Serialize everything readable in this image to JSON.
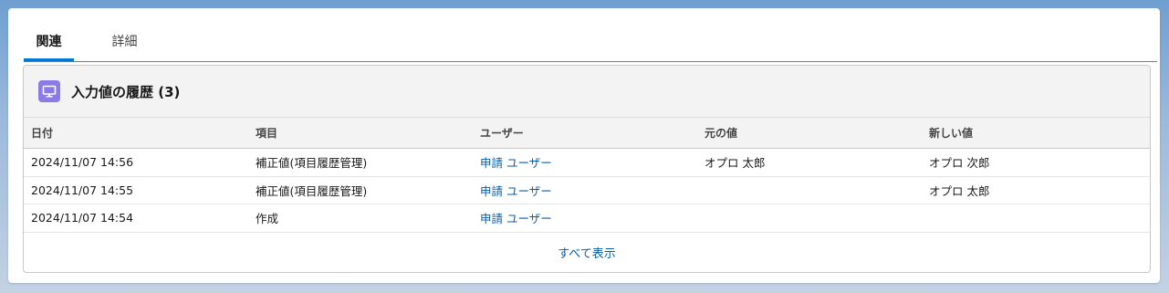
{
  "tabs": [
    {
      "label": "関連",
      "active": true
    },
    {
      "label": "詳細",
      "active": false
    }
  ],
  "panel": {
    "icon": "monitor-icon",
    "title": "入力値の履歴",
    "count": "(3)"
  },
  "table": {
    "headers": [
      "日付",
      "項目",
      "ユーザー",
      "元の値",
      "新しい値"
    ],
    "rows": [
      {
        "date": "2024/11/07 14:56",
        "field": "補正値(項目履歴管理)",
        "user": "申請 ユーザー",
        "old_value": "オプロ 太郎",
        "new_value": "オプロ 次郎"
      },
      {
        "date": "2024/11/07 14:55",
        "field": "補正値(項目履歴管理)",
        "user": "申請 ユーザー",
        "old_value": "",
        "new_value": "オプロ 太郎"
      },
      {
        "date": "2024/11/07 14:54",
        "field": "作成",
        "user": "申請 ユーザー",
        "old_value": "",
        "new_value": ""
      }
    ]
  },
  "footer": {
    "view_all": "すべて表示"
  },
  "colors": {
    "accent": "#0176d3",
    "link": "#0b5cab",
    "icon_bg": "#8c7ae6"
  }
}
